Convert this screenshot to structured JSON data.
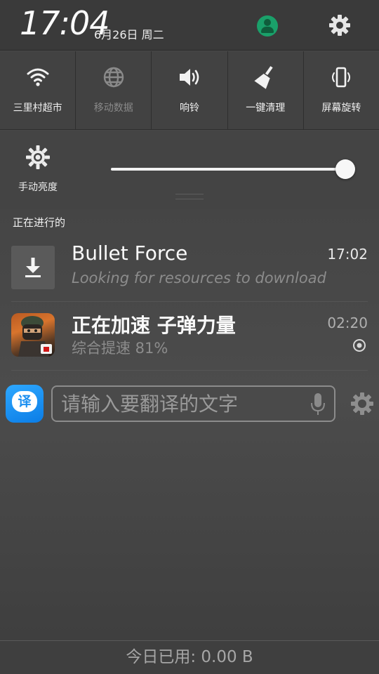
{
  "header": {
    "time": "17:04",
    "date": "6月26日 周二",
    "avatar_icon": "user-avatar-icon",
    "settings_icon": "gear-icon",
    "avatar_color": "#1aa06a"
  },
  "toggles": [
    {
      "label": "三里村超市",
      "icon": "wifi-icon",
      "active": true
    },
    {
      "label": "移动数据",
      "icon": "globe-icon",
      "active": false
    },
    {
      "label": "响铃",
      "icon": "speaker-icon",
      "active": true
    },
    {
      "label": "一键清理",
      "icon": "broom-icon",
      "active": true
    },
    {
      "label": "屏幕旋转",
      "icon": "rotate-icon",
      "active": true
    }
  ],
  "brightness": {
    "label": "手动亮度",
    "level": 1.0
  },
  "ongoing": {
    "header": "正在进行的",
    "notifications": [
      {
        "title": "Bullet Force",
        "text": "Looking for resources to download",
        "time": "17:02",
        "icon": "download-icon"
      },
      {
        "title": "正在加速 子弹力量",
        "text": "综合提速 81%",
        "time": "02:20",
        "icon": "game-app-icon"
      }
    ]
  },
  "translator": {
    "logo_text": "译",
    "placeholder": "请输入要翻译的文字",
    "mic_icon": "microphone-icon",
    "settings_icon": "gear-icon"
  },
  "footer": {
    "data_usage": "今日已用: 0.00 B"
  }
}
